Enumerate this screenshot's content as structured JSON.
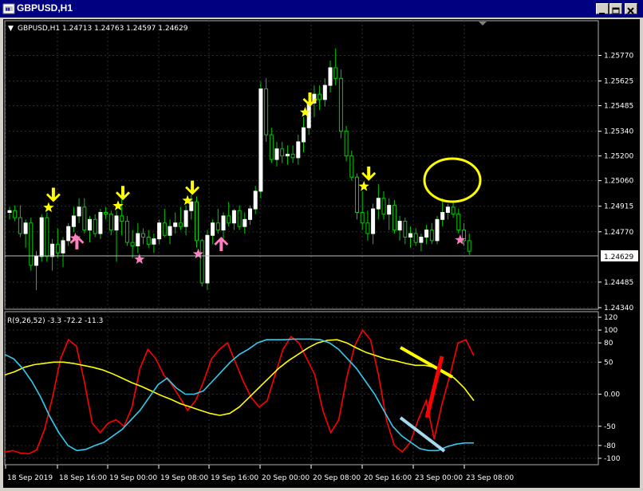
{
  "window": {
    "title": "GBPUSD,H1"
  },
  "price_panel": {
    "header": "GBPUSD,H1  1.24713 1.24763 1.24597 1.24629",
    "y_ticks": [
      "1.25770",
      "1.25625",
      "1.25485",
      "1.25340",
      "1.25200",
      "1.25060",
      "1.24915",
      "1.24770",
      "1.24629",
      "1.24485",
      "1.24340"
    ],
    "current_price": "1.24629"
  },
  "indicator_panel": {
    "header": "R(9,26,52) -3.3 -72.2 -11.3",
    "y_ticks": [
      "120",
      "100",
      "80",
      "50",
      "0.00",
      "-50",
      "-80",
      "-100"
    ]
  },
  "x_ticks": [
    "18 Sep 2019",
    "18 Sep 16:00",
    "19 Sep 00:00",
    "19 Sep 08:00",
    "19 Sep 16:00",
    "20 Sep 00:00",
    "20 Sep 08:00",
    "20 Sep 16:00",
    "23 Sep 00:00",
    "23 Sep 08:00"
  ],
  "colors": {
    "bg": "#000000",
    "grid": "#2f2f2f",
    "axis_text": "#ffffff",
    "bull": "#ffffff",
    "bear": "#00cc00",
    "fast": "#ff0000",
    "mid": "#ffff00",
    "slow": "#33ccee",
    "arrow_down": "#ffff00",
    "arrow_up": "#ff7fbf",
    "star_top": "#ffff00",
    "star_bottom": "#ff7fbf"
  },
  "chart_data": {
    "type": "candlestick",
    "symbol": "GBPUSD",
    "timeframe": "H1",
    "ylim": [
      1.2434,
      1.2584
    ],
    "candles": [
      [
        1.2488,
        1.2491,
        1.2484,
        1.2489
      ],
      [
        1.2489,
        1.2492,
        1.2483,
        1.2485
      ],
      [
        1.2485,
        1.2492,
        1.2474,
        1.2476
      ],
      [
        1.2476,
        1.2484,
        1.2468,
        1.2482
      ],
      [
        1.2482,
        1.2485,
        1.2455,
        1.2458
      ],
      [
        1.2458,
        1.2466,
        1.2444,
        1.2463
      ],
      [
        1.2463,
        1.2487,
        1.246,
        1.2485
      ],
      [
        1.2485,
        1.2488,
        1.246,
        1.2463
      ],
      [
        1.2463,
        1.2473,
        1.2455,
        1.247
      ],
      [
        1.247,
        1.2479,
        1.2462,
        1.2465
      ],
      [
        1.2465,
        1.2474,
        1.2457,
        1.2472
      ],
      [
        1.2472,
        1.2482,
        1.2469,
        1.248
      ],
      [
        1.248,
        1.2491,
        1.2477,
        1.2486
      ],
      [
        1.2486,
        1.2496,
        1.2482,
        1.2491
      ],
      [
        1.2491,
        1.2496,
        1.2476,
        1.2478
      ],
      [
        1.2478,
        1.2486,
        1.2471,
        1.2484
      ],
      [
        1.2484,
        1.2487,
        1.2474,
        1.2476
      ],
      [
        1.2476,
        1.249,
        1.2473,
        1.2488
      ],
      [
        1.2488,
        1.2491,
        1.2484,
        1.2487
      ],
      [
        1.2487,
        1.2489,
        1.2475,
        1.2478
      ],
      [
        1.2478,
        1.2489,
        1.246,
        1.2486
      ],
      [
        1.2486,
        1.2502,
        1.2475,
        1.2483
      ],
      [
        1.2483,
        1.2486,
        1.2469,
        1.2471
      ],
      [
        1.2471,
        1.2478,
        1.2462,
        1.2469
      ],
      [
        1.2469,
        1.2482,
        1.2465,
        1.2476
      ],
      [
        1.2476,
        1.2479,
        1.247,
        1.2474
      ],
      [
        1.2474,
        1.2478,
        1.2468,
        1.247
      ],
      [
        1.247,
        1.2476,
        1.2465,
        1.2473
      ],
      [
        1.2473,
        1.2484,
        1.247,
        1.2482
      ],
      [
        1.2482,
        1.249,
        1.2474,
        1.2475
      ],
      [
        1.2475,
        1.2484,
        1.247,
        1.248
      ],
      [
        1.248,
        1.2488,
        1.2476,
        1.2482
      ],
      [
        1.2482,
        1.2491,
        1.2478,
        1.248
      ],
      [
        1.248,
        1.2492,
        1.2475,
        1.2489
      ],
      [
        1.2489,
        1.2498,
        1.2484,
        1.2494
      ],
      [
        1.2494,
        1.2497,
        1.2468,
        1.2472
      ],
      [
        1.2472,
        1.2473,
        1.2446,
        1.2448
      ],
      [
        1.2448,
        1.2478,
        1.2444,
        1.2475
      ],
      [
        1.2475,
        1.2484,
        1.247,
        1.2482
      ],
      [
        1.2482,
        1.249,
        1.2476,
        1.2478
      ],
      [
        1.2478,
        1.2488,
        1.2473,
        1.2486
      ],
      [
        1.2486,
        1.2494,
        1.248,
        1.2482
      ],
      [
        1.2482,
        1.249,
        1.2478,
        1.2489
      ],
      [
        1.2489,
        1.2492,
        1.2478,
        1.248
      ],
      [
        1.248,
        1.2488,
        1.2476,
        1.2484
      ],
      [
        1.2484,
        1.2492,
        1.2481,
        1.249
      ],
      [
        1.249,
        1.2503,
        1.2487,
        1.25
      ],
      [
        1.25,
        1.2562,
        1.2496,
        1.2558
      ],
      [
        1.2558,
        1.2564,
        1.2528,
        1.2532
      ],
      [
        1.2532,
        1.2536,
        1.2516,
        1.2518
      ],
      [
        1.2518,
        1.2528,
        1.2514,
        1.2524
      ],
      [
        1.2524,
        1.2528,
        1.2516,
        1.252
      ],
      [
        1.252,
        1.2526,
        1.2515,
        1.2521
      ],
      [
        1.2521,
        1.2526,
        1.2516,
        1.2519
      ],
      [
        1.2519,
        1.2532,
        1.2515,
        1.2528
      ],
      [
        1.2528,
        1.2542,
        1.2522,
        1.2536
      ],
      [
        1.2536,
        1.2554,
        1.2532,
        1.255
      ],
      [
        1.255,
        1.256,
        1.2542,
        1.2555
      ],
      [
        1.2555,
        1.256,
        1.2546,
        1.2552
      ],
      [
        1.2552,
        1.2564,
        1.2548,
        1.256
      ],
      [
        1.256,
        1.2574,
        1.2556,
        1.257
      ],
      [
        1.257,
        1.2581,
        1.256,
        1.2564
      ],
      [
        1.2564,
        1.2569,
        1.253,
        1.2534
      ],
      [
        1.2534,
        1.2537,
        1.2517,
        1.252
      ],
      [
        1.252,
        1.2523,
        1.2506,
        1.2508
      ],
      [
        1.2508,
        1.251,
        1.2484,
        1.2488
      ],
      [
        1.2488,
        1.25,
        1.2478,
        1.2482
      ],
      [
        1.2482,
        1.2489,
        1.2472,
        1.2476
      ],
      [
        1.2476,
        1.2493,
        1.247,
        1.249
      ],
      [
        1.249,
        1.2504,
        1.2484,
        1.2496
      ],
      [
        1.2496,
        1.25,
        1.2484,
        1.2487
      ],
      [
        1.2487,
        1.2496,
        1.2478,
        1.2492
      ],
      [
        1.2492,
        1.2495,
        1.2476,
        1.2478
      ],
      [
        1.2478,
        1.2486,
        1.2472,
        1.2483
      ],
      [
        1.2483,
        1.2485,
        1.247,
        1.2474
      ],
      [
        1.2474,
        1.248,
        1.2468,
        1.2476
      ],
      [
        1.2476,
        1.2479,
        1.2469,
        1.2471
      ],
      [
        1.2471,
        1.2476,
        1.2466,
        1.2474
      ],
      [
        1.2474,
        1.2481,
        1.247,
        1.2478
      ],
      [
        1.2478,
        1.2482,
        1.247,
        1.2472
      ],
      [
        1.2472,
        1.2486,
        1.247,
        1.2484
      ],
      [
        1.2484,
        1.2496,
        1.248,
        1.2488
      ],
      [
        1.2488,
        1.2493,
        1.2484,
        1.2491
      ],
      [
        1.2491,
        1.2494,
        1.2485,
        1.2487
      ],
      [
        1.2487,
        1.249,
        1.2476,
        1.2478
      ],
      [
        1.2478,
        1.2482,
        1.2469,
        1.2472
      ],
      [
        1.2472,
        1.2476,
        1.2464,
        1.2466
      ]
    ],
    "indicator": {
      "name": "R(9,26,52)",
      "ylim": [
        -105,
        125
      ],
      "series": [
        {
          "values": [
            -90,
            -88,
            -92,
            -93,
            -87,
            -55,
            -5,
            55,
            85,
            75,
            20,
            -45,
            -60,
            -45,
            -40,
            -50,
            -20,
            40,
            70,
            55,
            30,
            15,
            -5,
            -25,
            -10,
            20,
            55,
            70,
            80,
            50,
            20,
            -5,
            -20,
            -10,
            30,
            70,
            90,
            80,
            55,
            30,
            -25,
            -60,
            -40,
            25,
            75,
            100,
            85,
            30,
            -40,
            -80,
            -90,
            -75,
            -40,
            -10,
            -70,
            -15,
            30,
            80,
            85,
            60
          ]
        },
        {
          "values": [
            30,
            35,
            42,
            46,
            48,
            50,
            50,
            48,
            45,
            42,
            38,
            32,
            25,
            18,
            12,
            5,
            -2,
            -8,
            -15,
            -20,
            -25,
            -30,
            -33,
            -30,
            -20,
            -5,
            10,
            25,
            40,
            52,
            62,
            72,
            80,
            84,
            85,
            80,
            72,
            65,
            60,
            55,
            52,
            48,
            45,
            45,
            42,
            35,
            25,
            10,
            -10
          ]
        },
        {
          "values": [
            62,
            55,
            40,
            20,
            -5,
            -35,
            -60,
            -80,
            -88,
            -86,
            -80,
            -75,
            -65,
            -55,
            -40,
            -25,
            -5,
            15,
            25,
            10,
            0,
            0,
            5,
            20,
            35,
            50,
            62,
            70,
            80,
            85,
            85,
            85,
            86,
            86,
            86,
            85,
            80,
            70,
            55,
            40,
            20,
            0,
            -25,
            -50,
            -65,
            -75,
            -85,
            -88,
            -88,
            -82,
            -78,
            -76,
            -76
          ]
        }
      ]
    },
    "annotations": {
      "sell_arrows": [
        7,
        20,
        33,
        55,
        66
      ],
      "buy_arrows": [
        12,
        39
      ],
      "star_top": [
        7,
        20,
        33,
        55,
        66
      ],
      "star_bottom": [
        12,
        24,
        35,
        84
      ]
    }
  }
}
